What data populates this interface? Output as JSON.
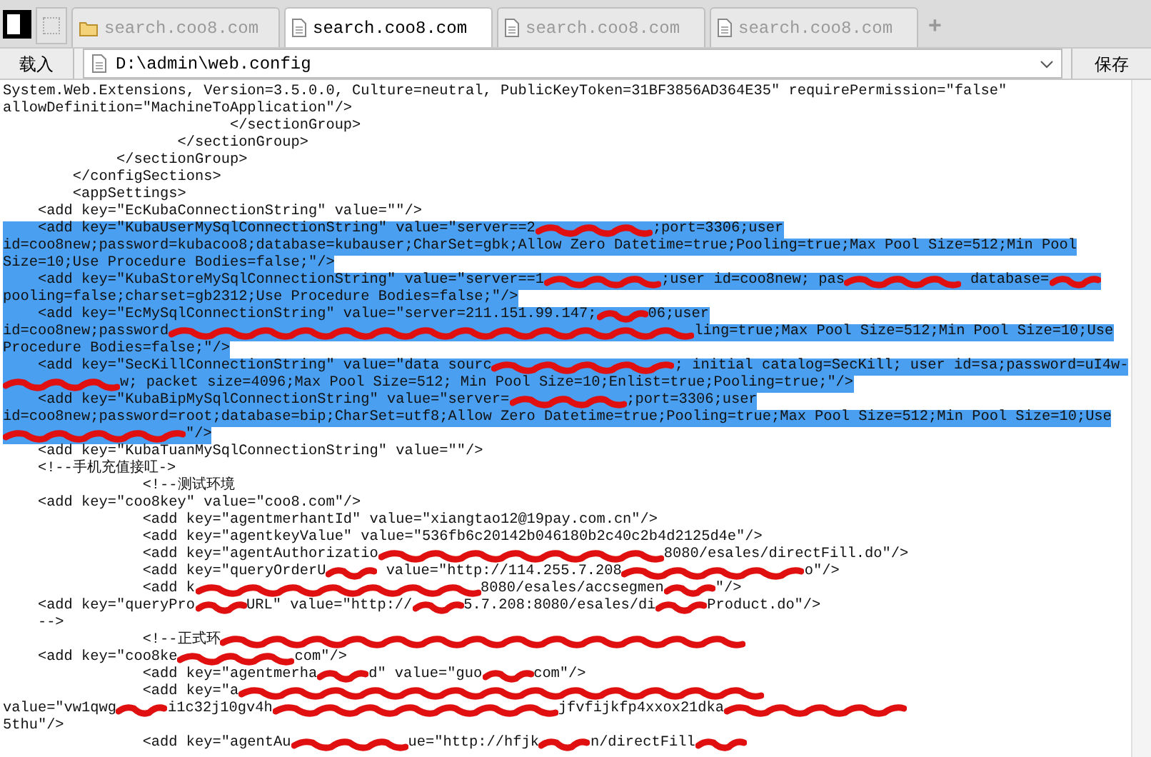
{
  "toolbar": {
    "tabs": [
      {
        "label": "search.coo8.com",
        "kind": "folder",
        "selected": false
      },
      {
        "label": "search.coo8.com",
        "kind": "document",
        "selected": true
      },
      {
        "label": "search.coo8.com",
        "kind": "document",
        "selected": false
      },
      {
        "label": "search.coo8.com",
        "kind": "document",
        "selected": false
      }
    ],
    "new_tab": "+"
  },
  "address_bar": {
    "load_button": "载入",
    "path": "D:\\admin\\web.config",
    "save_button": "保存"
  },
  "lines": [
    {
      "selected": false,
      "parts": [
        {
          "kind": "text",
          "text": "System.Web.Extensions, Version=3.5.0.0, Culture=neutral, PublicKeyToken=31BF3856AD364E35\" requirePermission=\"false\""
        }
      ]
    },
    {
      "selected": false,
      "parts": [
        {
          "kind": "text",
          "text": "allowDefinition=\"MachineToApplication\"/>"
        }
      ]
    },
    {
      "selected": false,
      "parts": [
        {
          "kind": "text",
          "text": "                          </sectionGroup>"
        }
      ]
    },
    {
      "selected": false,
      "parts": [
        {
          "kind": "text",
          "text": "                    </sectionGroup>"
        }
      ]
    },
    {
      "selected": false,
      "parts": [
        {
          "kind": "text",
          "text": "             </sectionGroup>"
        }
      ]
    },
    {
      "selected": false,
      "parts": [
        {
          "kind": "text",
          "text": "        </configSections>"
        }
      ]
    },
    {
      "selected": false,
      "parts": [
        {
          "kind": "text",
          "text": "        <appSettings>"
        }
      ]
    },
    {
      "selected": false,
      "parts": [
        {
          "kind": "text",
          "text": "    <add key=\"EcKubaConnectionString\" value=\"\"/>"
        }
      ]
    },
    {
      "selected": true,
      "parts": [
        {
          "kind": "text",
          "text": "    <add key=\"KubaUserMySqlConnectionString\" value=\"server==2"
        },
        {
          "kind": "strike"
        },
        {
          "kind": "text",
          "text": ";port=3306;user"
        }
      ]
    },
    {
      "selected": true,
      "parts": [
        {
          "kind": "text",
          "text": "id=coo8new;password=kubacoo8;database=kubauser;CharSet=gbk;Allow Zero Datetime=true;Pooling=true;Max Pool Size=512;Min Pool"
        }
      ]
    },
    {
      "selected": true,
      "parts": [
        {
          "kind": "text",
          "text": "Size=10;Use Procedure Bodies=false;\"/>"
        }
      ]
    },
    {
      "selected": true,
      "parts": [
        {
          "kind": "text",
          "text": "    <add key=\"KubaStoreMySqlConnectionString\" value=\"server==1"
        },
        {
          "kind": "strike"
        },
        {
          "kind": "text",
          "text": ";user id=coo8new; pas"
        },
        {
          "kind": "strike"
        },
        {
          "kind": "text",
          "text": " database="
        },
        {
          "kind": "dab"
        }
      ]
    },
    {
      "selected": true,
      "parts": [
        {
          "kind": "text",
          "text": "pooling=false;charset=gb2312;Use Procedure Bodies=false;\"/>"
        }
      ]
    },
    {
      "selected": true,
      "parts": [
        {
          "kind": "text",
          "text": "    <add key=\"EcMySqlConnectionString\" value=\"server=211.151.99.147;"
        },
        {
          "kind": "dab"
        },
        {
          "kind": "text",
          "text": "06;user"
        }
      ]
    },
    {
      "selected": true,
      "parts": [
        {
          "kind": "text",
          "text": "id=coo8new;password"
        },
        {
          "kind": "smear"
        },
        {
          "kind": "text",
          "text": "ling=true;Max Pool Size=512;Min Pool Size=10;Use"
        }
      ]
    },
    {
      "selected": true,
      "parts": [
        {
          "kind": "text",
          "text": "Procedure Bodies=false;\"/>"
        }
      ]
    },
    {
      "selected": true,
      "parts": [
        {
          "kind": "text",
          "text": "    <add key=\"SecKillConnectionString\" value=\"data sourc"
        },
        {
          "kind": "streak"
        },
        {
          "kind": "text",
          "text": "; initial catalog=SecKill; user id=sa;password=uI4w-"
        }
      ]
    },
    {
      "selected": true,
      "parts": [
        {
          "kind": "strike"
        },
        {
          "kind": "text",
          "text": "w; packet size=4096;Max Pool Size=512; Min Pool Size=10;Enlist=true;Pooling=true;\"/>"
        }
      ]
    },
    {
      "selected": true,
      "parts": [
        {
          "kind": "text",
          "text": "    <add key=\"KubaBipMySqlConnectionString\" value=\"server="
        },
        {
          "kind": "strike"
        },
        {
          "kind": "text",
          "text": ";port=3306;user"
        }
      ]
    },
    {
      "selected": true,
      "parts": [
        {
          "kind": "text",
          "text": "id=coo8new;password=root;database=bip;CharSet=utf8;Allow Zero Datetime=true;Pooling=true;Max Pool Size=512;Min Pool Size=10;Use"
        }
      ]
    },
    {
      "selected": true,
      "parts": [
        {
          "kind": "streak"
        },
        {
          "kind": "text",
          "text": "\"/>"
        }
      ]
    },
    {
      "selected": false,
      "parts": [
        {
          "kind": "text",
          "text": "    <add key=\"KubaTuanMySqlConnectionString\" value=\"\"/>"
        }
      ]
    },
    {
      "selected": false,
      "parts": [
        {
          "kind": "text",
          "text": "    <!--手机充值接叿->"
        }
      ]
    },
    {
      "selected": false,
      "parts": [
        {
          "kind": "text",
          "text": "                <!--测试环境"
        }
      ]
    },
    {
      "selected": false,
      "parts": [
        {
          "kind": "text",
          "text": "    <add key=\"coo8key\" value=\"coo8.com\"/>"
        }
      ]
    },
    {
      "selected": false,
      "parts": [
        {
          "kind": "text",
          "text": "                <add key=\"agentmerhantId\" value=\"xiangtao12@19pay.com.cn\"/>"
        }
      ]
    },
    {
      "selected": false,
      "parts": [
        {
          "kind": "text",
          "text": "                <add key=\"agentkeyValue\" value=\"536fb6c20142b046180b2c40c2b4d2125d4e\"/>"
        }
      ]
    },
    {
      "selected": false,
      "parts": [
        {
          "kind": "text",
          "text": "                <add key=\"agentAuthorizatio"
        },
        {
          "kind": "scrawl"
        },
        {
          "kind": "text",
          "text": "8080/esales/directFill.do\"/>"
        }
      ]
    },
    {
      "selected": false,
      "parts": [
        {
          "kind": "text",
          "text": "                <add key=\"queryOrderU"
        },
        {
          "kind": "dab"
        },
        {
          "kind": "text",
          "text": " value=\"http://114.255.7.208"
        },
        {
          "kind": "streak"
        },
        {
          "kind": "text",
          "text": "o\"/>"
        }
      ]
    },
    {
      "selected": false,
      "parts": [
        {
          "kind": "text",
          "text": "                <add k"
        },
        {
          "kind": "scrawl"
        },
        {
          "kind": "text",
          "text": "8080/esales/accsegmen"
        },
        {
          "kind": "dab"
        },
        {
          "kind": "text",
          "text": "\"/>"
        }
      ]
    },
    {
      "selected": false,
      "parts": [
        {
          "kind": "text",
          "text": "    <add key=\"queryPro"
        },
        {
          "kind": "dab"
        },
        {
          "kind": "text",
          "text": "URL\" value=\"http://"
        },
        {
          "kind": "dab"
        },
        {
          "kind": "text",
          "text": "5.7.208:8080/esales/di"
        },
        {
          "kind": "dab"
        },
        {
          "kind": "text",
          "text": "Product.do\"/>"
        }
      ]
    },
    {
      "selected": false,
      "parts": [
        {
          "kind": "text",
          "text": "    -->"
        }
      ]
    },
    {
      "selected": false,
      "parts": [
        {
          "kind": "text",
          "text": "                <!--正式环"
        },
        {
          "kind": "smear"
        }
      ]
    },
    {
      "selected": false,
      "parts": [
        {
          "kind": "text",
          "text": "    <add key=\"coo8ke"
        },
        {
          "kind": "strike"
        },
        {
          "kind": "text",
          "text": "com\"/>"
        }
      ]
    },
    {
      "selected": false,
      "parts": [
        {
          "kind": "text",
          "text": "                <add key=\"agentmerha"
        },
        {
          "kind": "dab"
        },
        {
          "kind": "text",
          "text": "d\" value=\"guo"
        },
        {
          "kind": "dab"
        },
        {
          "kind": "text",
          "text": "com\"/>"
        }
      ]
    },
    {
      "selected": false,
      "parts": [
        {
          "kind": "text",
          "text": "                <add key=\"a"
        },
        {
          "kind": "smear"
        }
      ]
    },
    {
      "selected": false,
      "parts": [
        {
          "kind": "text",
          "text": "value=\"vw1qwg"
        },
        {
          "kind": "dab"
        },
        {
          "kind": "text",
          "text": "i1c32j10gv4h"
        },
        {
          "kind": "scrawl"
        },
        {
          "kind": "text",
          "text": "jfvfijkfp4xxox21dka"
        },
        {
          "kind": "streak"
        }
      ]
    },
    {
      "selected": false,
      "parts": [
        {
          "kind": "text",
          "text": "5thu\"/>"
        }
      ]
    },
    {
      "selected": false,
      "parts": [
        {
          "kind": "text",
          "text": "                <add key=\"agentAu"
        },
        {
          "kind": "strike"
        },
        {
          "kind": "text",
          "text": "ue=\"http://hfjk"
        },
        {
          "kind": "dab"
        },
        {
          "kind": "text",
          "text": "n/directFill"
        },
        {
          "kind": "dab"
        }
      ]
    }
  ]
}
